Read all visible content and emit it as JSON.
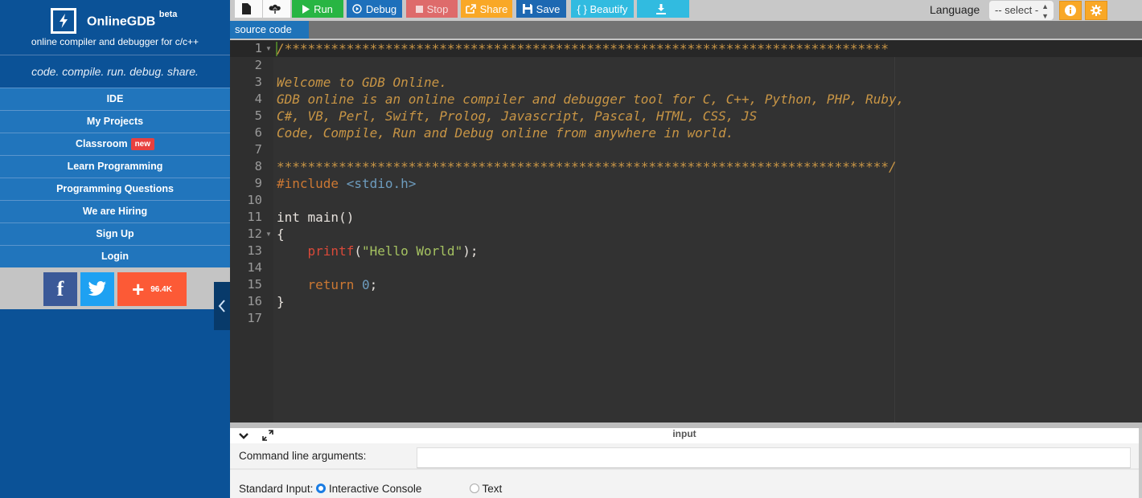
{
  "brand": {
    "name": "OnlineGDB",
    "beta": "beta",
    "subtitle": "online compiler and debugger for c/c++",
    "tagline": "code. compile. run. debug. share."
  },
  "sidebar": {
    "items": [
      {
        "label": "IDE"
      },
      {
        "label": "My Projects"
      },
      {
        "label": "Classroom",
        "badge": "new"
      },
      {
        "label": "Learn Programming"
      },
      {
        "label": "Programming Questions"
      },
      {
        "label": "We are Hiring"
      },
      {
        "label": "Sign Up"
      },
      {
        "label": "Login"
      }
    ],
    "social": {
      "facebook_glyph": "f",
      "share_count": "96.4K"
    }
  },
  "toolbar": {
    "run": "Run",
    "debug": "Debug",
    "stop": "Stop",
    "share": "Share",
    "save": "Save",
    "beautify": "{ } Beautify",
    "language_label": "Language",
    "language_selected": "-- select -"
  },
  "colors": {
    "run": "#28b543",
    "debug": "#1e70bb",
    "stop": "#de6b6b",
    "share": "#f9a826",
    "save": "#1d68b2",
    "beautify": "#31bbe0",
    "download": "#31bbe0",
    "sidebar": "#0b5297"
  },
  "tabs": [
    {
      "label": "source code"
    }
  ],
  "editor": {
    "line_numbers": [
      "1",
      "2",
      "3",
      "4",
      "5",
      "6",
      "7",
      "8",
      "9",
      "10",
      "11",
      "12",
      "13",
      "14",
      "15",
      "16",
      "17"
    ],
    "lines": [
      "/******************************************************************************",
      "",
      "Welcome to GDB Online.",
      "GDB online is an online compiler and debugger tool for C, C++, Python, PHP, Ruby, ",
      "C#, VB, Perl, Swift, Prolog, Javascript, Pascal, HTML, CSS, JS",
      "Code, Compile, Run and Debug online from anywhere in world.",
      "",
      "*******************************************************************************/",
      "",
      "",
      "int main()",
      "{",
      "",
      "",
      "",
      "}",
      ""
    ],
    "include_kw": "#include",
    "include_file": "<stdio.h>",
    "printf_fn": "printf",
    "printf_open": "(",
    "printf_str": "\"Hello World\"",
    "printf_close": ");",
    "return_kw": "return",
    "return_val": "0",
    "return_end": ";"
  },
  "io": {
    "title": "input",
    "cmd_label": "Command line arguments:",
    "cmd_value": "",
    "stdin_label": "Standard Input:",
    "stdin_options": [
      {
        "label": "Interactive Console",
        "selected": true
      },
      {
        "label": "Text",
        "selected": false
      }
    ]
  }
}
